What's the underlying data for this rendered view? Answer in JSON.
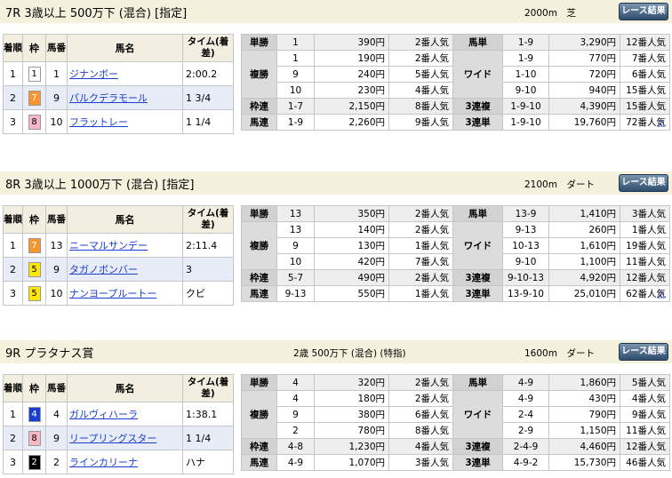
{
  "races": [
    {
      "title": "7R 3歳以上 500万下 (混合) [指定]",
      "class_note": "",
      "dist_surface": "2000m　芝",
      "result_button": "レース結果",
      "headers": {
        "chakujun": "着順",
        "waku": "枠",
        "umaban": "馬番",
        "name": "馬名",
        "time": "タイム(着差)"
      },
      "rows": [
        {
          "chakujun": "1",
          "waku": "1",
          "umaban": "1",
          "name": "ジナンボー",
          "time": "2:00.2"
        },
        {
          "chakujun": "2",
          "waku": "7",
          "umaban": "9",
          "name": "パルクデラモール",
          "time": "1 3/4"
        },
        {
          "chakujun": "3",
          "waku": "8",
          "umaban": "10",
          "name": "フラットレー",
          "time": "1 1/4"
        }
      ],
      "payout": {
        "tansho": {
          "label": "単勝",
          "rows": [
            [
              "1",
              "390円",
              "2番人気"
            ]
          ]
        },
        "fukusho": {
          "label": "複勝",
          "rows": [
            [
              "1",
              "190円",
              "2番人気"
            ],
            [
              "9",
              "240円",
              "5番人気"
            ],
            [
              "10",
              "230円",
              "4番人気"
            ]
          ]
        },
        "wakuren": {
          "label": "枠連",
          "rows": [
            [
              "1-7",
              "2,150円",
              "8番人気"
            ]
          ]
        },
        "umaren": {
          "label": "馬連",
          "rows": [
            [
              "1-9",
              "2,260円",
              "9番人気"
            ]
          ]
        },
        "umatan": {
          "label": "馬単",
          "rows": [
            [
              "1-9",
              "3,290円",
              "12番人気"
            ]
          ]
        },
        "wide": {
          "label": "ワイド",
          "rows": [
            [
              "1-9",
              "770円",
              "7番人気"
            ],
            [
              "1-10",
              "720円",
              "6番人気"
            ],
            [
              "9-10",
              "940円",
              "15番人気"
            ]
          ]
        },
        "sanrenpuku": {
          "label": "3連複",
          "rows": [
            [
              "1-9-10",
              "4,390円",
              "15番人気"
            ]
          ]
        },
        "sanrentan": {
          "label": "3連単",
          "rows": [
            [
              "1-9-10",
              "19,760円",
              "72番人気"
            ]
          ]
        }
      },
      "up_icon": "△"
    },
    {
      "title": "8R 3歳以上 1000万下 (混合) [指定]",
      "class_note": "",
      "dist_surface": "2100m　ダート",
      "result_button": "レース結果",
      "headers": {
        "chakujun": "着順",
        "waku": "枠",
        "umaban": "馬番",
        "name": "馬名",
        "time": "タイム(着差)"
      },
      "rows": [
        {
          "chakujun": "1",
          "waku": "7",
          "umaban": "13",
          "name": "ニーマルサンデー",
          "time": "2:11.4"
        },
        {
          "chakujun": "2",
          "waku": "5",
          "umaban": "9",
          "name": "タガノボンバー",
          "time": "3"
        },
        {
          "chakujun": "3",
          "waku": "5",
          "umaban": "10",
          "name": "ナンヨープルートー",
          "time": "クビ"
        }
      ],
      "payout": {
        "tansho": {
          "label": "単勝",
          "rows": [
            [
              "13",
              "350円",
              "2番人気"
            ]
          ]
        },
        "fukusho": {
          "label": "複勝",
          "rows": [
            [
              "13",
              "140円",
              "2番人気"
            ],
            [
              "9",
              "130円",
              "1番人気"
            ],
            [
              "10",
              "420円",
              "7番人気"
            ]
          ]
        },
        "wakuren": {
          "label": "枠連",
          "rows": [
            [
              "5-7",
              "490円",
              "2番人気"
            ]
          ]
        },
        "umaren": {
          "label": "馬連",
          "rows": [
            [
              "9-13",
              "550円",
              "1番人気"
            ]
          ]
        },
        "umatan": {
          "label": "馬単",
          "rows": [
            [
              "13-9",
              "1,410円",
              "3番人気"
            ]
          ]
        },
        "wide": {
          "label": "ワイド",
          "rows": [
            [
              "9-13",
              "260円",
              "1番人気"
            ],
            [
              "10-13",
              "1,610円",
              "19番人気"
            ],
            [
              "9-10",
              "1,100円",
              "11番人気"
            ]
          ]
        },
        "sanrenpuku": {
          "label": "3連複",
          "rows": [
            [
              "9-10-13",
              "4,920円",
              "12番人気"
            ]
          ]
        },
        "sanrentan": {
          "label": "3連単",
          "rows": [
            [
              "13-9-10",
              "25,010円",
              "62番人気"
            ]
          ]
        }
      },
      "up_icon": "△"
    },
    {
      "title": "9R プラタナス賞",
      "class_note": "2歳 500万下 (混合) (特指)",
      "dist_surface": "1600m　ダート",
      "result_button": "レース結果",
      "headers": {
        "chakujun": "着順",
        "waku": "枠",
        "umaban": "馬番",
        "name": "馬名",
        "time": "タイム(着差)"
      },
      "rows": [
        {
          "chakujun": "1",
          "waku": "4",
          "umaban": "4",
          "name": "ガルヴィハーラ",
          "time": "1:38.1"
        },
        {
          "chakujun": "2",
          "waku": "8",
          "umaban": "9",
          "name": "リープリングスター",
          "time": "1 1/4"
        },
        {
          "chakujun": "3",
          "waku": "2",
          "umaban": "2",
          "name": "ラインカリーナ",
          "time": "ハナ"
        }
      ],
      "payout": {
        "tansho": {
          "label": "単勝",
          "rows": [
            [
              "4",
              "320円",
              "2番人気"
            ]
          ]
        },
        "fukusho": {
          "label": "複勝",
          "rows": [
            [
              "4",
              "180円",
              "2番人気"
            ],
            [
              "9",
              "380円",
              "6番人気"
            ],
            [
              "2",
              "780円",
              "8番人気"
            ]
          ]
        },
        "wakuren": {
          "label": "枠連",
          "rows": [
            [
              "4-8",
              "1,230円",
              "4番人気"
            ]
          ]
        },
        "umaren": {
          "label": "馬連",
          "rows": [
            [
              "4-9",
              "1,070円",
              "3番人気"
            ]
          ]
        },
        "umatan": {
          "label": "馬単",
          "rows": [
            [
              "4-9",
              "1,860円",
              "5番人気"
            ]
          ]
        },
        "wide": {
          "label": "ワイド",
          "rows": [
            [
              "4-9",
              "430円",
              "4番人気"
            ],
            [
              "2-4",
              "790円",
              "9番人気"
            ],
            [
              "2-9",
              "1,150円",
              "11番人気"
            ]
          ]
        },
        "sanrenpuku": {
          "label": "3連複",
          "rows": [
            [
              "2-4-9",
              "4,460円",
              "12番人気"
            ]
          ]
        },
        "sanrentan": {
          "label": "3連単",
          "rows": [
            [
              "4-9-2",
              "15,730円",
              "46番人気"
            ]
          ]
        }
      },
      "up_icon": ""
    }
  ],
  "waku_colors": {
    "1": {
      "bg": "#ffffff",
      "fg": "#000000"
    },
    "2": {
      "bg": "#000000",
      "fg": "#ffffff"
    },
    "3": {
      "bg": "#e8231b",
      "fg": "#ffffff"
    },
    "4": {
      "bg": "#1a3fd0",
      "fg": "#ffffff"
    },
    "5": {
      "bg": "#ffe800",
      "fg": "#000000"
    },
    "6": {
      "bg": "#2e9b35",
      "fg": "#ffffff"
    },
    "7": {
      "bg": "#f7962e",
      "fg": "#ffffff"
    },
    "8": {
      "bg": "#f7b7c6",
      "fg": "#000000"
    }
  }
}
